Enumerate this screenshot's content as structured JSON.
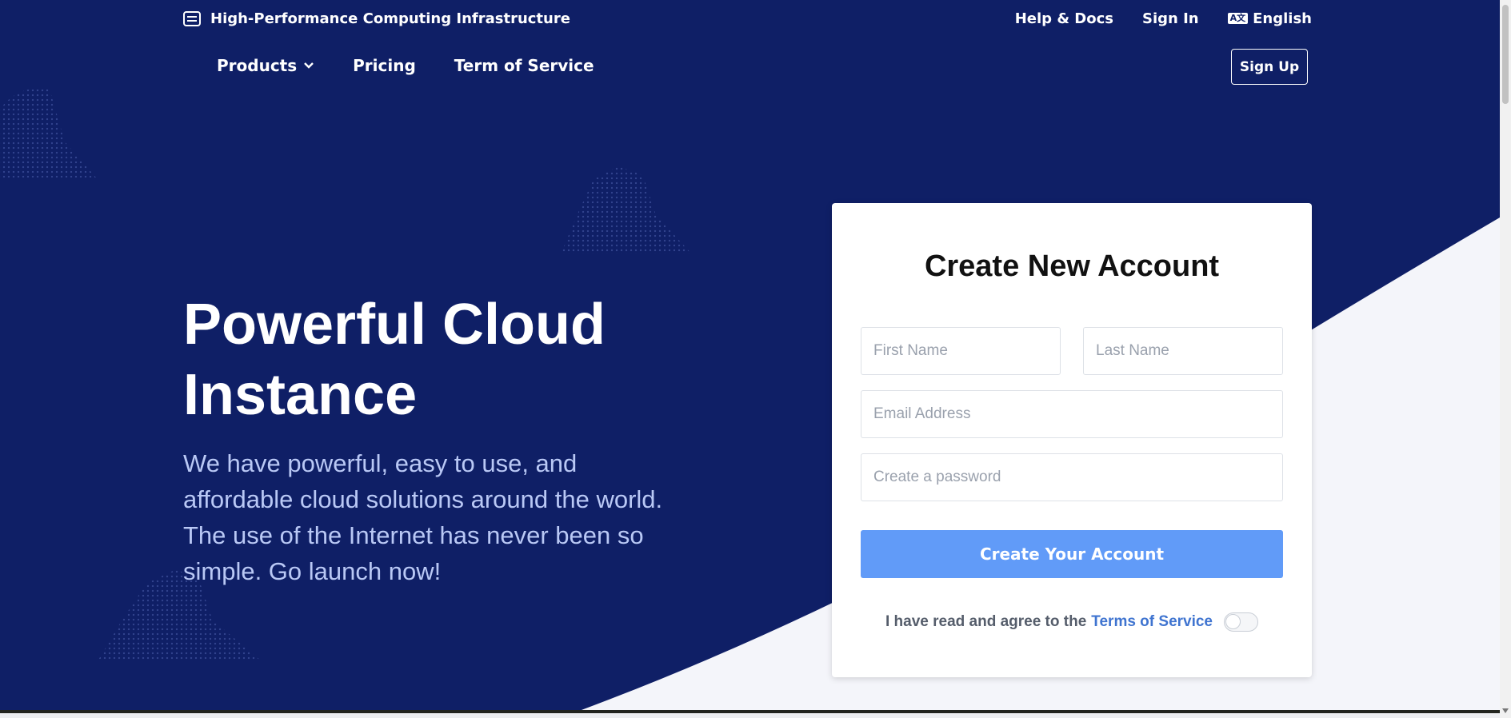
{
  "colors": {
    "background_navy": "#0f1f66",
    "light_bg": "#f4f5fa",
    "primary_button": "#619bf8",
    "link_blue": "#3f74d0"
  },
  "header": {
    "brand_icon": "server-icon",
    "brand_title": "High-Performance Computing Infrastructure",
    "help_docs": "Help & Docs",
    "sign_in": "Sign In",
    "language_icon": "translate-icon",
    "language_icon_text": "A文",
    "language": "English"
  },
  "nav": {
    "products": "Products",
    "products_icon": "chevron-down-icon",
    "pricing": "Pricing",
    "terms": "Term of Service",
    "sign_up": "Sign Up"
  },
  "hero": {
    "title": "Powerful Cloud Instance",
    "subtitle": "We have powerful, easy to use, and affordable cloud solutions around the world. The use of the Internet has never been so simple. Go launch now!"
  },
  "signup_form": {
    "title": "Create New Account",
    "first_name_placeholder": "First Name",
    "first_name_value": "",
    "last_name_placeholder": "Last Name",
    "last_name_value": "",
    "email_placeholder": "Email Address",
    "email_value": "",
    "password_placeholder": "Create a password",
    "password_value": "",
    "submit_label": "Create Your Account",
    "agree_text": "I have read and agree to the",
    "terms_link": "Terms of Service",
    "agree_toggle_on": false
  }
}
